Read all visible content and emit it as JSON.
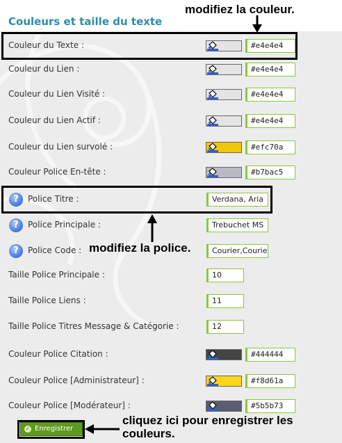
{
  "section_title": "Couleurs et taille du texte",
  "rows": [
    {
      "label": "Couleur du Texte  :",
      "kind": "color",
      "value": "#e4e4e4",
      "swatch": "#e4e4e4"
    },
    {
      "label": "Couleur du Lien  :",
      "kind": "color",
      "value": "#e4e4e4",
      "swatch": "#e4e4e4"
    },
    {
      "label": "Couleur du Lien Visité  :",
      "kind": "color",
      "value": "#e4e4e4",
      "swatch": "#e4e4e4"
    },
    {
      "label": "Couleur du Lien Actif  :",
      "kind": "color",
      "value": "#e4e4e4",
      "swatch": "#e4e4e4"
    },
    {
      "label": "Couleur du Lien survolé  :",
      "kind": "color",
      "value": "#efc70a",
      "swatch": "#efc70a"
    },
    {
      "label": "Couleur Police En-tête  :",
      "kind": "color",
      "value": "#b7bac5",
      "swatch": "#b7bac5"
    },
    {
      "label": "Police Titre  :",
      "kind": "font",
      "value": "Verdana, Aria",
      "help": true
    },
    {
      "label": "Police Principale  :",
      "kind": "font",
      "value": "Trebuchet MS",
      "help": true
    },
    {
      "label": "Police Code  :",
      "kind": "font",
      "value": "Courier,Courie",
      "help": true
    },
    {
      "label": "Taille Police Principale  :",
      "kind": "size",
      "value": "10"
    },
    {
      "label": "Taille Police Liens  :",
      "kind": "size",
      "value": "11"
    },
    {
      "label": "Taille Police Titres Message & Catégorie  :",
      "kind": "size",
      "value": "12"
    },
    {
      "label": "Couleur Police Citation  :",
      "kind": "color",
      "value": "#444444",
      "swatch": "#444444"
    },
    {
      "label": "Couleur Police [Administrateur]  :",
      "kind": "color",
      "value": "#f8d61a",
      "swatch": "#f8d61a"
    },
    {
      "label": "Couleur Police [Modérateur]  :",
      "kind": "color",
      "value": "#5b5b73",
      "swatch": "#5b5b73"
    }
  ],
  "help_glyph": "?",
  "save_button": {
    "label": "Enregistrer",
    "icon": "check-icon"
  },
  "annotations": {
    "color": "modifiez la couleur.",
    "font": "modifiez la police.",
    "save": "cliquez ici pour enregistrer les couleurs."
  },
  "colors": {
    "accent_title": "#2f8caa",
    "input_border": "#8cc63f",
    "button_bg": "#5f9a1f"
  }
}
